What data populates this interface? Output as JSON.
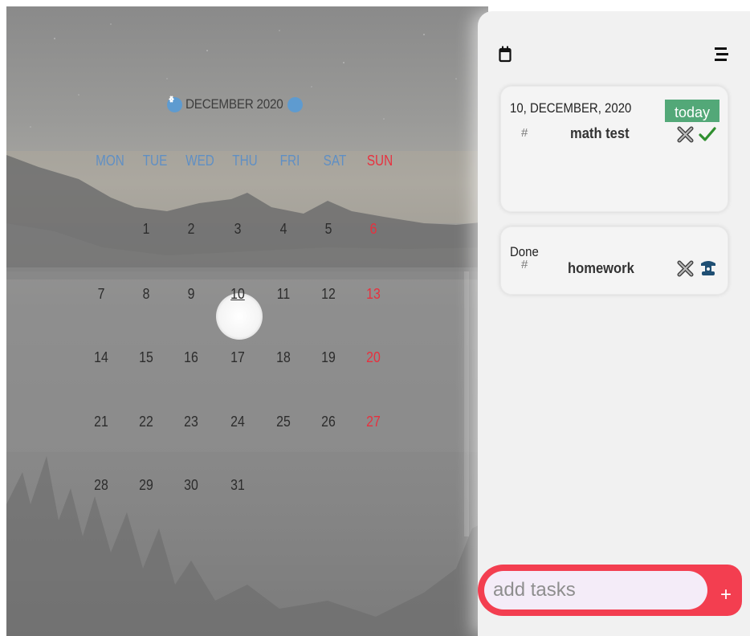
{
  "calendar": {
    "month_title": "DECEMBER 2020",
    "weekdays": [
      "MON",
      "TUE",
      "WED",
      "THU",
      "FRI",
      "SAT",
      "SUN"
    ],
    "weeks": [
      [
        "",
        "1",
        "2",
        "3",
        "4",
        "5",
        "6"
      ],
      [
        "7",
        "8",
        "9",
        "10",
        "11",
        "12",
        "13"
      ],
      [
        "14",
        "15",
        "16",
        "17",
        "18",
        "19",
        "20"
      ],
      [
        "21",
        "22",
        "23",
        "24",
        "25",
        "26",
        "27"
      ],
      [
        "28",
        "29",
        "30",
        "31",
        "",
        "",
        ""
      ]
    ],
    "selected_day": "10",
    "colors": {
      "weekday": "#5f8fc4",
      "sunday": "#e8303e",
      "nav": "#5e9bd0"
    }
  },
  "panel": {
    "icons": {
      "calendar": "calendar-icon",
      "menu": "menu-icon"
    },
    "tasks": [
      {
        "date_label": "10, DECEMBER, 2020",
        "badge": "today",
        "hash": "#",
        "title": "math test",
        "actions": [
          "delete-icon",
          "check-icon"
        ]
      },
      {
        "date_label": "Done",
        "hash": "#",
        "title": "homework",
        "actions": [
          "delete-icon",
          "undo-icon"
        ]
      }
    ]
  },
  "add_task": {
    "placeholder": "add tasks",
    "button_label": "+"
  },
  "colors": {
    "accent": "#f33e50",
    "badge": "#53a878",
    "panel": "#f1f1f1"
  }
}
